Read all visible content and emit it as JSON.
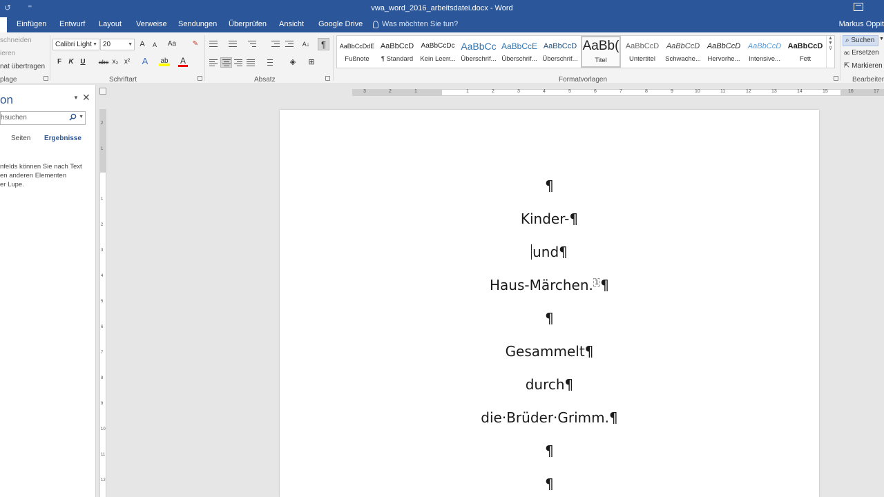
{
  "title_bar": {
    "title": "vwa_word_2016_arbeitsdatei.docx - Word",
    "qat_items": [
      "↺",
      "⁼"
    ]
  },
  "tabs": [
    "Einfügen",
    "Entwurf",
    "Layout",
    "Verweise",
    "Sendungen",
    "Überprüfen",
    "Ansicht",
    "Google Drive"
  ],
  "tell_me": "Was möchten Sie tun?",
  "user": "Markus Oppit",
  "clipboard": {
    "items": [
      "schneiden",
      "ieren",
      "nat übertragen"
    ],
    "label": "plage"
  },
  "font": {
    "name": "Calibri Light",
    "size": "20",
    "grow": "A",
    "shrink": "A",
    "case": "Aa",
    "bold": "F",
    "italic": "K",
    "underline": "U",
    "strike": "abc",
    "subscript": "x₂",
    "superscript": "x²",
    "effects": "A",
    "highlight": "ab",
    "color": "A",
    "label": "Schriftart"
  },
  "paragraph": {
    "label": "Absatz",
    "pilcrow": "¶",
    "sort": "A↓"
  },
  "styles": {
    "label": "Formatvorlagen",
    "items": [
      {
        "sample": "AaBbCcDdE",
        "name": "Fußnote"
      },
      {
        "sample": "AaBbCcD",
        "name": "¶ Standard"
      },
      {
        "sample": "AaBbCcDc",
        "name": "Kein Leerr..."
      },
      {
        "sample": "AaBbCc",
        "name": "Überschrif..."
      },
      {
        "sample": "AaBbCcE",
        "name": "Überschrif..."
      },
      {
        "sample": "AaBbCcD",
        "name": "Überschrif..."
      },
      {
        "sample": "AaBb(",
        "name": "Titel"
      },
      {
        "sample": "AaBbCcD",
        "name": "Untertitel"
      },
      {
        "sample": "AaBbCcD",
        "name": "Schwache..."
      },
      {
        "sample": "AaBbCcD",
        "name": "Hervorhe..."
      },
      {
        "sample": "AaBbCcD",
        "name": "Intensive..."
      },
      {
        "sample": "AaBbCcD",
        "name": "Fett"
      }
    ]
  },
  "editing": {
    "label": "Bearbeiten",
    "search": "Suchen",
    "replace": "Ersetzen",
    "select": "Markieren"
  },
  "nav_pane": {
    "title": "on",
    "search_placeholder": "hsuchen",
    "tab_pages": "Seiten",
    "tab_results": "Ergebnisse",
    "info_lines": [
      "nfelds können Sie nach Text",
      "en anderen Elementen",
      "er Lupe."
    ]
  },
  "document": {
    "lines": [
      "¶",
      "Kinder-¶",
      "und¶",
      "Haus-Märchen.",
      "¶",
      "Gesammelt¶",
      "durch¶",
      "die·Brüder·Grimm.¶",
      "¶",
      "¶"
    ],
    "footnote_ref": "1",
    "after_ref": "¶"
  },
  "ruler": {
    "h_numbers": [
      "3",
      "2",
      "1",
      "1",
      "2",
      "3",
      "4",
      "5",
      "6",
      "7",
      "8",
      "9",
      "10",
      "11",
      "12",
      "13",
      "14",
      "15",
      "16",
      "17"
    ],
    "v_numbers": [
      "2",
      "1",
      "1",
      "2",
      "3",
      "4",
      "5",
      "6",
      "7",
      "8",
      "9",
      "10",
      "11",
      "12"
    ]
  },
  "colors": {
    "word_blue": "#2b579a",
    "ribbon_bg": "#f3f3f3",
    "workspace": "#e6e6e6"
  }
}
